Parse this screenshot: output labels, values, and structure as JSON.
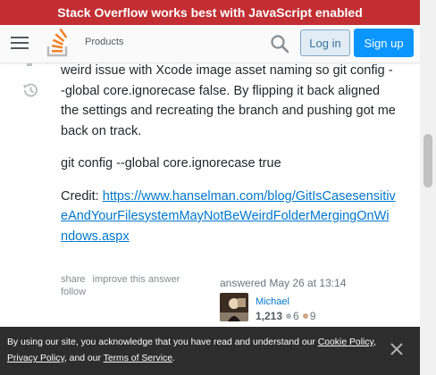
{
  "banner": {
    "text": "Stack Overflow works best with JavaScript enabled"
  },
  "topbar": {
    "products_label": "Products",
    "login_label": "Log in",
    "signup_label": "Sign up"
  },
  "post": {
    "para1": "weird issue with Xcode image asset naming so git config --global core.ignorecase false. By flipping it back aligned the settings and recreating the branch and pushing got me back on track.",
    "para2": "git config --global core.ignorecase true",
    "credit_label": "Credit: ",
    "credit_link": "https://www.hanselman.com/blog/GitIsCasesensitiveAndYourFilesystemMayNotBeWeirdFolderMergingOnWindows.aspx"
  },
  "post_menu": {
    "share": "share",
    "improve": "improve this answer",
    "follow": "follow"
  },
  "user": {
    "answered": "answered May 26 at 13:14",
    "name": "Michael",
    "reputation": "1,213",
    "silver": "6",
    "bronze": "9"
  },
  "cookie": {
    "text1": "By using our site, you acknowledge that you have read and understand our ",
    "cookie_policy": "Cookie Policy",
    "sep1": ", ",
    "privacy_policy": "Privacy Policy",
    "sep2": ", and our ",
    "terms": "Terms of Service",
    "end": "."
  },
  "icons": {
    "menu": "hamburger-icon",
    "logo": "stackoverflow-logo",
    "search": "search-icon",
    "history": "history-icon",
    "close": "close-icon"
  },
  "colors": {
    "banner": "#c22e32",
    "link": "#0077cc",
    "primary_button": "#0a95ff",
    "silver_badge": "#b4b8bc",
    "bronze_badge": "#d1a684",
    "cookie_bg": "#2d2d2d"
  }
}
